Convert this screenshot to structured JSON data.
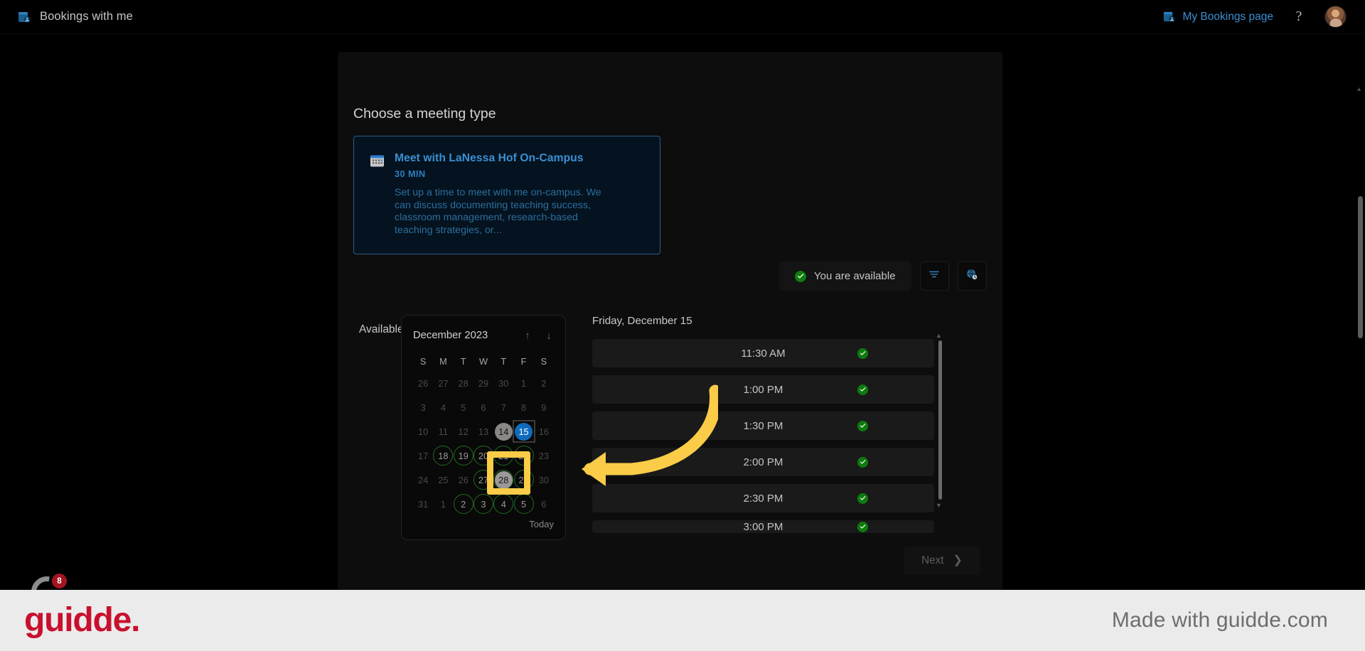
{
  "topbar": {
    "brand_icon": "bookings-icon",
    "brand_title": "Bookings with me",
    "my_bookings_label": "My Bookings page",
    "my_bookings_icon": "bookings-page-icon",
    "help_label": "?",
    "avatar_name": "user-avatar"
  },
  "main": {
    "section_title": "Choose a meeting type",
    "meeting": {
      "icon": "calendar-icon",
      "title": "Meet with LaNessa Hof On-Campus",
      "duration": "30 MIN",
      "description": "Set up a time to meet with me on-campus. We can discuss documenting teaching success, classroom management, research-based teaching strategies, or..."
    },
    "available_times_label": "Available times",
    "availability_pill": {
      "icon": "check-circle-icon",
      "label": "You are available"
    },
    "filter_icon": "filter-icon",
    "timezone_icon": "globe-clock-icon"
  },
  "calendar": {
    "month_label": "December 2023",
    "prev_icon": "arrow-up-icon",
    "next_icon": "arrow-down-icon",
    "day_headers": [
      "S",
      "M",
      "T",
      "W",
      "T",
      "F",
      "S"
    ],
    "today_link": "Today",
    "weeks": [
      [
        {
          "d": "26",
          "state": "muted"
        },
        {
          "d": "27",
          "state": "muted"
        },
        {
          "d": "28",
          "state": "muted"
        },
        {
          "d": "29",
          "state": "muted"
        },
        {
          "d": "30",
          "state": "muted"
        },
        {
          "d": "1",
          "state": "muted"
        },
        {
          "d": "2",
          "state": "muted"
        }
      ],
      [
        {
          "d": "3",
          "state": "muted"
        },
        {
          "d": "4",
          "state": "muted"
        },
        {
          "d": "5",
          "state": "muted"
        },
        {
          "d": "6",
          "state": "muted"
        },
        {
          "d": "7",
          "state": "muted"
        },
        {
          "d": "8",
          "state": "muted"
        },
        {
          "d": "9",
          "state": "muted"
        }
      ],
      [
        {
          "d": "10",
          "state": "muted"
        },
        {
          "d": "11",
          "state": "muted"
        },
        {
          "d": "12",
          "state": "muted"
        },
        {
          "d": "13",
          "state": "muted"
        },
        {
          "d": "14",
          "state": "today"
        },
        {
          "d": "15",
          "state": "selected"
        },
        {
          "d": "16",
          "state": "muted"
        }
      ],
      [
        {
          "d": "17",
          "state": "muted"
        },
        {
          "d": "18",
          "state": "avail"
        },
        {
          "d": "19",
          "state": "avail"
        },
        {
          "d": "20",
          "state": "avail"
        },
        {
          "d": "21",
          "state": "avail"
        },
        {
          "d": "22",
          "state": "avail"
        },
        {
          "d": "23",
          "state": "muted"
        }
      ],
      [
        {
          "d": "24",
          "state": "muted"
        },
        {
          "d": "25",
          "state": "muted"
        },
        {
          "d": "26",
          "state": "muted"
        },
        {
          "d": "27",
          "state": "avail"
        },
        {
          "d": "28",
          "state": "avail-picked"
        },
        {
          "d": "29",
          "state": "avail"
        },
        {
          "d": "30",
          "state": "muted"
        }
      ],
      [
        {
          "d": "31",
          "state": "muted"
        },
        {
          "d": "1",
          "state": "muted"
        },
        {
          "d": "2",
          "state": "avail"
        },
        {
          "d": "3",
          "state": "avail"
        },
        {
          "d": "4",
          "state": "avail"
        },
        {
          "d": "5",
          "state": "avail"
        },
        {
          "d": "6",
          "state": "muted"
        }
      ]
    ]
  },
  "slots": {
    "date_heading": "Friday, December 15",
    "items": [
      {
        "time": "11:30 AM",
        "status": "available"
      },
      {
        "time": "1:00 PM",
        "status": "available"
      },
      {
        "time": "1:30 PM",
        "status": "available"
      },
      {
        "time": "2:00 PM",
        "status": "available"
      },
      {
        "time": "2:30 PM",
        "status": "available"
      },
      {
        "time": "3:00 PM",
        "status": "available"
      }
    ]
  },
  "footer_actions": {
    "next_label": "Next",
    "next_icon": "chevron-right-icon"
  },
  "branding": {
    "logo_text": "guidde.",
    "made_with": "Made with guidde.com",
    "badge_count": "8"
  },
  "annotation": {
    "highlight_target": "calendar-day-28",
    "arrow_color": "#facc47"
  }
}
